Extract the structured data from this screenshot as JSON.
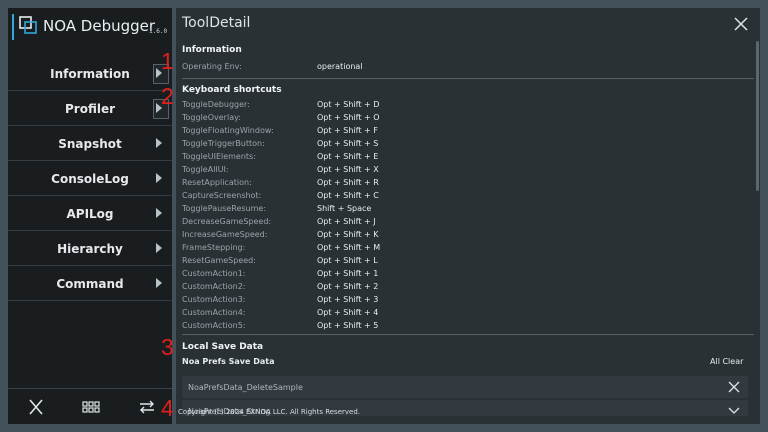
{
  "app": {
    "name": "NOA Debugger",
    "version": "1.6.0"
  },
  "sidebar": {
    "items": [
      {
        "label": "Information"
      },
      {
        "label": "Profiler"
      },
      {
        "label": "Snapshot"
      },
      {
        "label": "ConsoleLog"
      },
      {
        "label": "APILog"
      },
      {
        "label": "Hierarchy"
      },
      {
        "label": "Command"
      }
    ],
    "bottom_icons": [
      "close-icon",
      "grid-icon",
      "swap-arrows-icon"
    ]
  },
  "markers": [
    "1",
    "2",
    "3",
    "4"
  ],
  "panel": {
    "title": "ToolDetail",
    "information": {
      "heading": "Information",
      "rows": [
        {
          "key": "Operating Env:",
          "value": "operational"
        }
      ]
    },
    "shortcuts": {
      "heading": "Keyboard shortcuts",
      "rows": [
        {
          "key": "ToggleDebugger:",
          "value": "Opt + Shift + D"
        },
        {
          "key": "ToggleOverlay:",
          "value": "Opt + Shift + O"
        },
        {
          "key": "ToggleFloatingWindow:",
          "value": "Opt + Shift + F"
        },
        {
          "key": "ToggleTriggerButton:",
          "value": "Opt + Shift + S"
        },
        {
          "key": "ToggleUIElements:",
          "value": "Opt + Shift + E"
        },
        {
          "key": "ToggleAllUI:",
          "value": "Opt + Shift + X"
        },
        {
          "key": "ResetApplication:",
          "value": "Opt + Shift + R"
        },
        {
          "key": "CaptureScreenshot:",
          "value": "Opt + Shift + C"
        },
        {
          "key": "TogglePauseResume:",
          "value": "Shift + Space"
        },
        {
          "key": "DecreaseGameSpeed:",
          "value": "Opt + Shift + J"
        },
        {
          "key": "IncreaseGameSpeed:",
          "value": "Opt + Shift + K"
        },
        {
          "key": "FrameStepping:",
          "value": "Opt + Shift + M"
        },
        {
          "key": "ResetGameSpeed:",
          "value": "Opt + Shift + L"
        },
        {
          "key": "CustomAction1:",
          "value": "Opt + Shift + 1"
        },
        {
          "key": "CustomAction2:",
          "value": "Opt + Shift + 2"
        },
        {
          "key": "CustomAction3:",
          "value": "Opt + Shift + 3"
        },
        {
          "key": "CustomAction4:",
          "value": "Opt + Shift + 4"
        },
        {
          "key": "CustomAction5:",
          "value": "Opt + Shift + 5"
        }
      ]
    },
    "local_save": {
      "heading": "Local Save Data",
      "subheading": "Noa Prefs Save Data",
      "all_clear_label": "All Clear",
      "entries": [
        {
          "label": "NoaPrefsData_DeleteSample",
          "action_icon": "close-icon"
        },
        {
          "label": "NoaPrefsData_String",
          "action_icon": "chevron-down-icon"
        }
      ]
    },
    "copyright": "Copyright (c) 2024 EXNOA LLC. All Rights Reserved."
  },
  "colors": {
    "background": "#42515a",
    "sidebar": "#191d20",
    "panel": "#2a3135",
    "accent": "#2fa8d8",
    "marker": "#e0201c"
  }
}
